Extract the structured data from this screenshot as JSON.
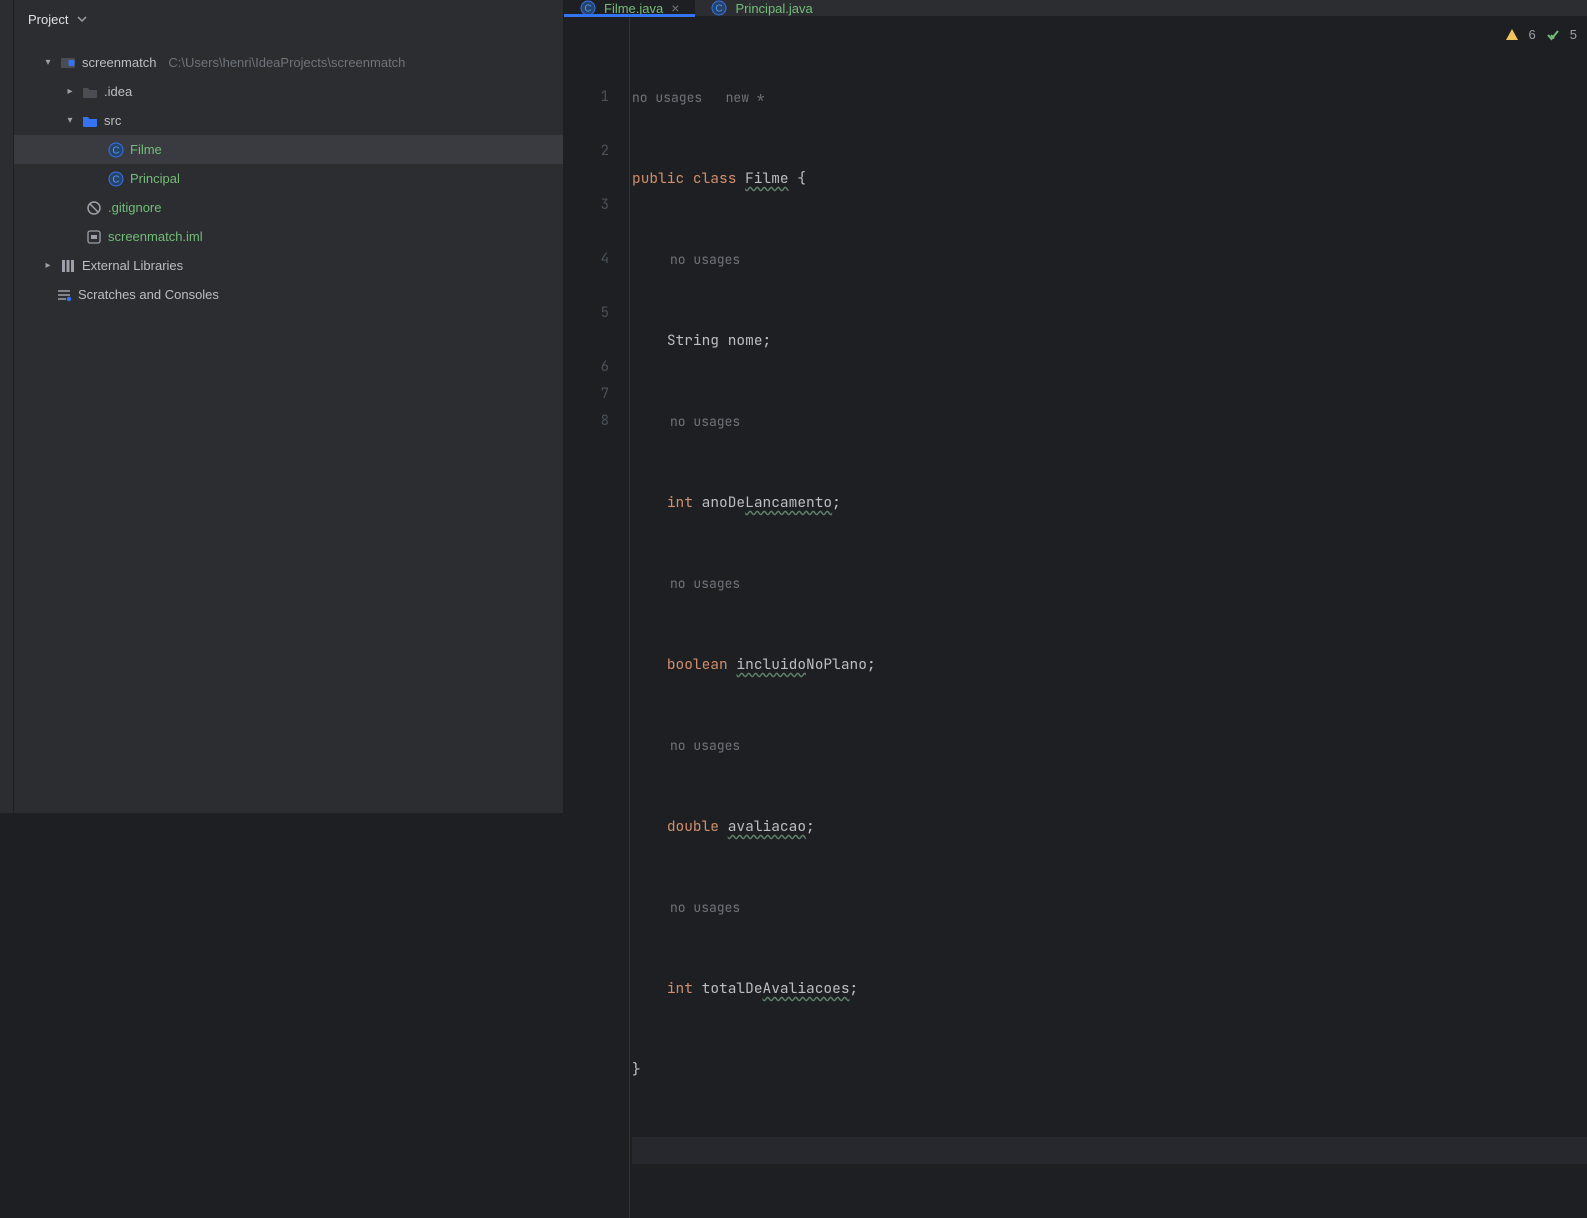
{
  "panel": {
    "title": "Project"
  },
  "tree": {
    "root": {
      "name": "screenmatch",
      "path": "C:\\Users\\henri\\IdeaProjects\\screenmatch"
    },
    "idea": ".idea",
    "src": "src",
    "filme": "Filme",
    "principal": "Principal",
    "gitignore": ".gitignore",
    "iml": "screenmatch.iml",
    "external": "External Libraries",
    "scratches": "Scratches and Consoles"
  },
  "tabs": {
    "active": "Filme.java",
    "other": "Principal.java"
  },
  "inspections": {
    "warn": "6",
    "ok": "5"
  },
  "hints": {
    "nousages": "no usages",
    "new": "new *"
  },
  "gutter": [
    "1",
    "2",
    "3",
    "4",
    "5",
    "6",
    "7",
    "8"
  ],
  "code": {
    "kw_public": "public",
    "kw_class": "class",
    "cls_name": "Filme",
    "brace_open": " {",
    "brace_close": "}",
    "l2_kw": "String",
    "l2_id": "nome",
    "l3_kw": "int",
    "l3_id": "anoDe",
    "l3_id2": "Lancamento",
    "l4_kw": "boolean",
    "l4_id": "incluido",
    "l4_id2": "NoPlano",
    "l5_kw": "double",
    "l5_id": "avaliacao",
    "l6_kw": "int",
    "l6_id": "totalDe",
    "l6_id2": "Avaliacoes",
    "semi": ";"
  }
}
